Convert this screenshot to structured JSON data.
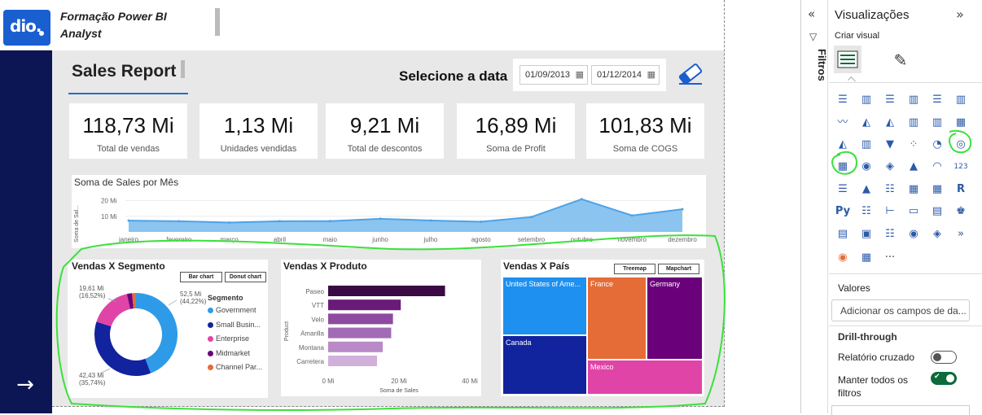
{
  "app": {
    "title": "Formação Power BI Analyst",
    "logo_text": "dio."
  },
  "report": {
    "title": "Sales Report",
    "date_label": "Selecione a data",
    "date_start": "01/09/2013",
    "date_end": "01/12/2014"
  },
  "kpis": [
    {
      "value": "118,73 Mi",
      "label": "Total de vendas"
    },
    {
      "value": "1,13 Mi",
      "label": "Unidades vendidas"
    },
    {
      "value": "9,21 Mi",
      "label": "Total de descontos"
    },
    {
      "value": "16,89 Mi",
      "label": "Soma de Profit"
    },
    {
      "value": "101,83 Mi",
      "label": "Soma de COGS"
    }
  ],
  "chart_data": [
    {
      "type": "area",
      "title": "Soma de Sales por Mês",
      "ylabel": "Soma de Sal...",
      "yticks": [
        "20 Mi",
        "10 Mi"
      ],
      "categories": [
        "janeiro",
        "fevereiro",
        "março",
        "abril",
        "maio",
        "junho",
        "julho",
        "agosto",
        "setembro",
        "outubro",
        "novembro",
        "dezembro"
      ],
      "values": [
        7.2,
        6.8,
        6.0,
        6.8,
        6.9,
        8.4,
        7.3,
        6.5,
        9.5,
        20.9,
        10.5,
        14.5
      ],
      "color": "#4da3e8",
      "ylim": [
        0,
        26
      ]
    },
    {
      "type": "pie",
      "title": "Vendas X Segmento",
      "buttons": [
        "Bar chart",
        "Donut chart"
      ],
      "legend_title": "Segmento",
      "series": [
        {
          "name": "Government",
          "value": 52.5,
          "color": "#2e9be8"
        },
        {
          "name": "Small Busin...",
          "value": 42.43,
          "color": "#12239e"
        },
        {
          "name": "Enterprise",
          "value": 19.61,
          "color": "#e044a7"
        },
        {
          "name": "Midmarket",
          "value": 2.38,
          "color": "#6b007b"
        },
        {
          "name": "Channel Par...",
          "value": 1.8,
          "color": "#e66c37"
        }
      ],
      "labels": [
        {
          "line1": "52,5 Mi",
          "line2": "(44,22%)"
        },
        {
          "line1": "42,43 Mi",
          "line2": "(35,74%)"
        },
        {
          "line1": "19,61 Mi",
          "line2": "(16,52%)"
        }
      ]
    },
    {
      "type": "bar",
      "title": "Vendas X Produto",
      "ylabel": "Product",
      "xlabel": "Soma de Sales",
      "xticks": [
        "0 Mi",
        "20 Mi",
        "40 Mi"
      ],
      "xlim": [
        0,
        40
      ],
      "categories": [
        "Paseo",
        "VTT",
        "Velo",
        "Amarilla",
        "Montana",
        "Carretera"
      ],
      "values": [
        33.0,
        20.5,
        18.3,
        17.8,
        15.4,
        13.8
      ],
      "colors": [
        "#3b0a45",
        "#6a1a78",
        "#8e4aa0",
        "#a36ab5",
        "#b98ac7",
        "#d1b0da"
      ]
    },
    {
      "type": "heatmap",
      "title": "Vendas X País",
      "buttons": [
        "Treemap",
        "Mapchart"
      ],
      "items": [
        {
          "name": "United States of Ame...",
          "color": "#1e90f0"
        },
        {
          "name": "France",
          "color": "#e66c37"
        },
        {
          "name": "Germany",
          "color": "#6b007b"
        },
        {
          "name": "Canada",
          "color": "#12239e"
        },
        {
          "name": "Mexico",
          "color": "#e044a7"
        }
      ]
    }
  ],
  "right_panel": {
    "filters_label": "Filtros",
    "title": "Visualizações",
    "create_visual": "Criar visual",
    "values_label": "Valores",
    "values_placeholder": "Adicionar os campos de da...",
    "drill_title": "Drill-through",
    "cross_report": "Relatório cruzado",
    "keep_filters_l1": "Manter todos os",
    "keep_filters_l2": "filtros",
    "cross_report_state": "off",
    "keep_filters_state": "on",
    "more": "···",
    "r_label": "R",
    "py_label": "Py",
    "num_label": "123"
  }
}
